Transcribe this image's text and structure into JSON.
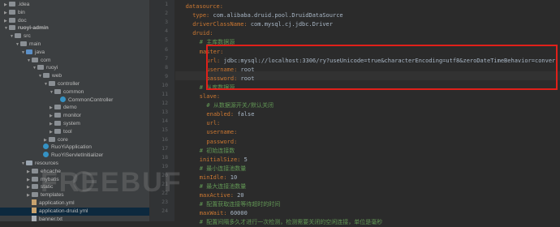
{
  "project_tree": [
    {
      "label": ".idea",
      "icon": "folder-gray",
      "indent": 1,
      "arrow": "closed"
    },
    {
      "label": "bin",
      "icon": "folder-gray",
      "indent": 1,
      "arrow": "closed"
    },
    {
      "label": "doc",
      "icon": "folder-gray",
      "indent": 1,
      "arrow": "closed"
    },
    {
      "label": "ruoyi-admin",
      "icon": "folder-gray",
      "indent": 1,
      "arrow": "open"
    },
    {
      "label": "src",
      "icon": "folder-gray",
      "indent": 2,
      "arrow": "open"
    },
    {
      "label": "main",
      "icon": "folder-gray",
      "indent": 3,
      "arrow": "open"
    },
    {
      "label": "java",
      "icon": "folder-blue",
      "indent": 4,
      "arrow": "open"
    },
    {
      "label": "com",
      "icon": "folder-gray",
      "indent": 5,
      "arrow": "open"
    },
    {
      "label": "ruoyi",
      "icon": "folder-gray",
      "indent": 6,
      "arrow": "open"
    },
    {
      "label": "web",
      "icon": "folder-gray",
      "indent": 7,
      "arrow": "open"
    },
    {
      "label": "controller",
      "icon": "folder-gray",
      "indent": 8,
      "arrow": "open"
    },
    {
      "label": "common",
      "icon": "folder-gray",
      "indent": 9,
      "arrow": "open"
    },
    {
      "label": "CommonController",
      "icon": "java-class",
      "indent": 10,
      "arrow": "none"
    },
    {
      "label": "demo",
      "icon": "folder-gray",
      "indent": 9,
      "arrow": "closed"
    },
    {
      "label": "monitor",
      "icon": "folder-gray",
      "indent": 9,
      "arrow": "closed"
    },
    {
      "label": "system",
      "icon": "folder-gray",
      "indent": 9,
      "arrow": "closed"
    },
    {
      "label": "tool",
      "icon": "folder-gray",
      "indent": 9,
      "arrow": "closed"
    },
    {
      "label": "core",
      "icon": "folder-gray",
      "indent": 8,
      "arrow": "closed"
    },
    {
      "label": "RuoYiApplication",
      "icon": "java-class",
      "indent": 7,
      "arrow": "none"
    },
    {
      "label": "RuoYiServletInitializer",
      "icon": "java-class",
      "indent": 7,
      "arrow": "none"
    },
    {
      "label": "resources",
      "icon": "folder-res",
      "indent": 4,
      "arrow": "open"
    },
    {
      "label": "ehcache",
      "icon": "folder-gray",
      "indent": 5,
      "arrow": "closed"
    },
    {
      "label": "mybatis",
      "icon": "folder-gray",
      "indent": 5,
      "arrow": "closed"
    },
    {
      "label": "static",
      "icon": "folder-gray",
      "indent": 5,
      "arrow": "closed"
    },
    {
      "label": "templates",
      "icon": "folder-gray",
      "indent": 5,
      "arrow": "closed"
    },
    {
      "label": "application.yml",
      "icon": "yml-file",
      "indent": 5,
      "arrow": "none"
    },
    {
      "label": "application-druid.yml",
      "icon": "yml-file",
      "indent": 5,
      "arrow": "none",
      "selected": true
    },
    {
      "label": "banner.txt",
      "icon": "txt-file",
      "indent": 5,
      "arrow": "none"
    }
  ],
  "line_numbers": [
    "1",
    "2",
    "3",
    "4",
    "5",
    "6",
    "7",
    "8",
    "9",
    "10",
    "11",
    "12",
    "13",
    "14",
    "15",
    "16",
    "17",
    "18",
    "19",
    "20",
    "21",
    "22",
    "23",
    "24"
  ],
  "code_lines": [
    {
      "indent": 2,
      "key": "datasource",
      "value": "",
      "comment": ""
    },
    {
      "indent": 4,
      "key": "type",
      "value": "com.alibaba.druid.pool.DruidDataSource",
      "comment": ""
    },
    {
      "indent": 4,
      "key": "driverClassName",
      "value": "com.mysql.cj.jdbc.Driver",
      "comment": ""
    },
    {
      "indent": 4,
      "key": "druid",
      "value": "",
      "comment": ""
    },
    {
      "indent": 6,
      "key": "",
      "value": "",
      "comment": "# 主库数据源"
    },
    {
      "indent": 6,
      "key": "master",
      "value": "",
      "comment": ""
    },
    {
      "indent": 8,
      "key": "url",
      "value": "jdbc:mysql://localhost:3306/ry?useUnicode=true&characterEncoding=utf8&zeroDateTimeBehavior=conver",
      "comment": ""
    },
    {
      "indent": 8,
      "key": "username",
      "value": "root",
      "comment": ""
    },
    {
      "indent": 8,
      "key": "password",
      "value": "root",
      "comment": ""
    },
    {
      "indent": 6,
      "key": "",
      "value": "",
      "comment": "# 从库数据源"
    },
    {
      "indent": 6,
      "key": "slave",
      "value": "",
      "comment": ""
    },
    {
      "indent": 8,
      "key": "",
      "value": "",
      "comment": "# 从数据源开关/默认关闭"
    },
    {
      "indent": 8,
      "key": "enabled",
      "value": "false",
      "comment": ""
    },
    {
      "indent": 8,
      "key": "url",
      "value": "",
      "comment": ""
    },
    {
      "indent": 8,
      "key": "username",
      "value": "",
      "comment": ""
    },
    {
      "indent": 8,
      "key": "password",
      "value": "",
      "comment": ""
    },
    {
      "indent": 6,
      "key": "",
      "value": "",
      "comment": "# 初始连接数"
    },
    {
      "indent": 6,
      "key": "initialSize",
      "value": "5",
      "comment": ""
    },
    {
      "indent": 6,
      "key": "",
      "value": "",
      "comment": "# 最小连接池数量"
    },
    {
      "indent": 6,
      "key": "minIdle",
      "value": "10",
      "comment": ""
    },
    {
      "indent": 6,
      "key": "",
      "value": "",
      "comment": "# 最大连接池数量"
    },
    {
      "indent": 6,
      "key": "maxActive",
      "value": "20",
      "comment": ""
    },
    {
      "indent": 6,
      "key": "",
      "value": "",
      "comment": "# 配置获取连接等待超时的时间"
    },
    {
      "indent": 6,
      "key": "maxWait",
      "value": "60000",
      "comment": ""
    },
    {
      "indent": 6,
      "key": "",
      "value": "",
      "comment": "# 配置间隔多久才进行一次检测，检测需要关闭的空闲连接，单位是毫秒"
    }
  ],
  "watermark": "FREEBUF",
  "colors": {
    "key": "#cc7832",
    "value": "#a9b7c6",
    "comment": "#629755",
    "highlight_box": "#e0201a"
  }
}
